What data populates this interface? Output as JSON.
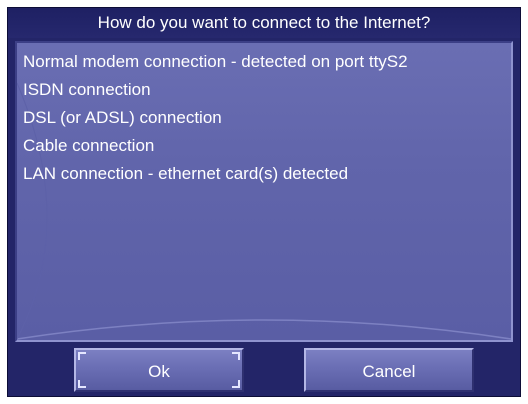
{
  "dialog": {
    "title": "How do you want to connect to the Internet?"
  },
  "options": [
    {
      "label": "Normal modem connection - detected on port ttyS2"
    },
    {
      "label": "ISDN connection"
    },
    {
      "label": "DSL (or ADSL) connection"
    },
    {
      "label": "Cable connection"
    },
    {
      "label": "LAN connection - ethernet card(s) detected"
    }
  ],
  "buttons": {
    "ok_label": "Ok",
    "cancel_label": "Cancel"
  },
  "colors": {
    "dialog_background": "#232568",
    "list_background": "#6a6eb3",
    "button_face": "#6a6eb4",
    "text": "#ffffff"
  }
}
